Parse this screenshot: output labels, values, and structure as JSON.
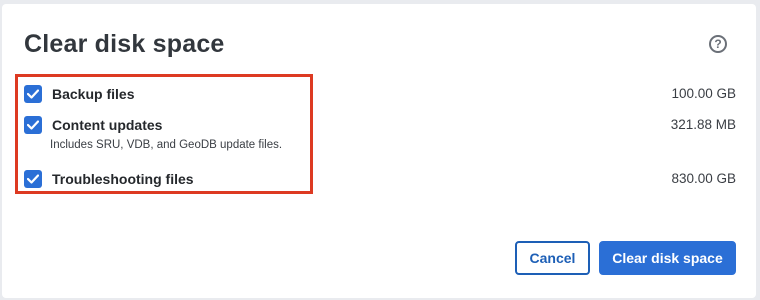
{
  "dialog": {
    "title": "Clear disk space",
    "help_icon": "question-circle-icon",
    "help_glyph": "?"
  },
  "items": [
    {
      "label": "Backup files",
      "checked": true,
      "size": "100.00 GB"
    },
    {
      "label": "Content updates",
      "checked": true,
      "size": "321.88 MB",
      "description": "Includes SRU, VDB, and GeoDB update files."
    },
    {
      "label": "Troubleshooting files",
      "checked": true,
      "size": "830.00 GB"
    }
  ],
  "buttons": {
    "cancel": "Cancel",
    "confirm": "Clear disk space"
  },
  "colors": {
    "accent": "#2b6fd6",
    "highlight_border": "#dd3a22",
    "title_text": "#32373d"
  }
}
